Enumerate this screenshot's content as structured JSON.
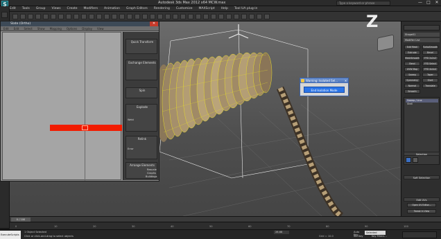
{
  "window": {
    "app_icon": "S",
    "title": "Autodesk 3ds Max 2012 x64     MCW.max",
    "search_placeholder": "Type a keyword or phrase",
    "minimize": "—",
    "maximize": "□",
    "close": "✕"
  },
  "menu": [
    "Edit",
    "Tools",
    "Group",
    "Views",
    "Create",
    "Modifiers",
    "Animation",
    "Graph Editors",
    "Rendering",
    "Customize",
    "MAXScript",
    "Help",
    "Tool UA plug-in"
  ],
  "schematic": {
    "title": "Slate (Ortho)",
    "menu": [
      "Edit",
      "Edit",
      "Select",
      "Show",
      "Mapping",
      "Options",
      "Display",
      "View"
    ],
    "panels": [
      {
        "title": "Quick Transform",
        "items": []
      },
      {
        "title": "Exchange Elements",
        "items": []
      },
      {
        "title": "Spin",
        "items": []
      },
      {
        "title": "Explode",
        "items": [
          "Weld"
        ]
      },
      {
        "title": "Relink",
        "items": [
          "Error"
        ]
      },
      {
        "title": "Arrange Elements",
        "items": [
          "Rescale",
          "Graphs",
          "Buildings"
        ]
      }
    ]
  },
  "dialog": {
    "title": "Warning: Isolated Sel...",
    "button": "End Isolation Mode"
  },
  "command_panel": {
    "object_name": "Shape01",
    "modifier_list": "Modifier List",
    "buttons": [
      [
        "Edit Mesh",
        "TurboSmooth"
      ],
      [
        "Extrude",
        "Bevel"
      ],
      [
        "MeshSmooth",
        "FFD 2x2x2"
      ],
      [
        "Bend",
        "FFD Select"
      ],
      [
        "UVW Map",
        "FFD 4x4x4"
      ],
      [
        "Sweep",
        "Taper"
      ],
      [
        "Symmetry",
        "Shell"
      ],
      [
        "Normal",
        "Translate"
      ],
      [
        "Smooth",
        ""
      ]
    ],
    "stack_items": [
      "Sweep / Line",
      "Shell"
    ],
    "selection_title": "Selection",
    "soft_selection_title": "Soft Selection",
    "edit_uv_title": "Edit UVs",
    "edit_uv_button": "Open UV Editor...",
    "tweak_button": "Tweak In View"
  },
  "timeline": {
    "frame_display": "0 / 100",
    "ticks": [
      "0",
      "10",
      "20",
      "30",
      "40",
      "50",
      "60",
      "70",
      "80",
      "90",
      "100"
    ]
  },
  "status": {
    "script_label": "ExecuteScripts",
    "selection_text": "1 Object Selected",
    "prompt_text": "Click or click-and-drag to select objects",
    "x_value": "28.68",
    "y_value": "",
    "grid_text": "Grid = 10.0",
    "autokey_label": "Auto Key",
    "autokey_value": "Selected",
    "setkey_label": "Set Key",
    "filters_label": "Key Filters..."
  },
  "colors": {
    "red_bar": "#f21c00",
    "dialog_button": "#2a74e8",
    "wire": "#e6dd2a"
  }
}
